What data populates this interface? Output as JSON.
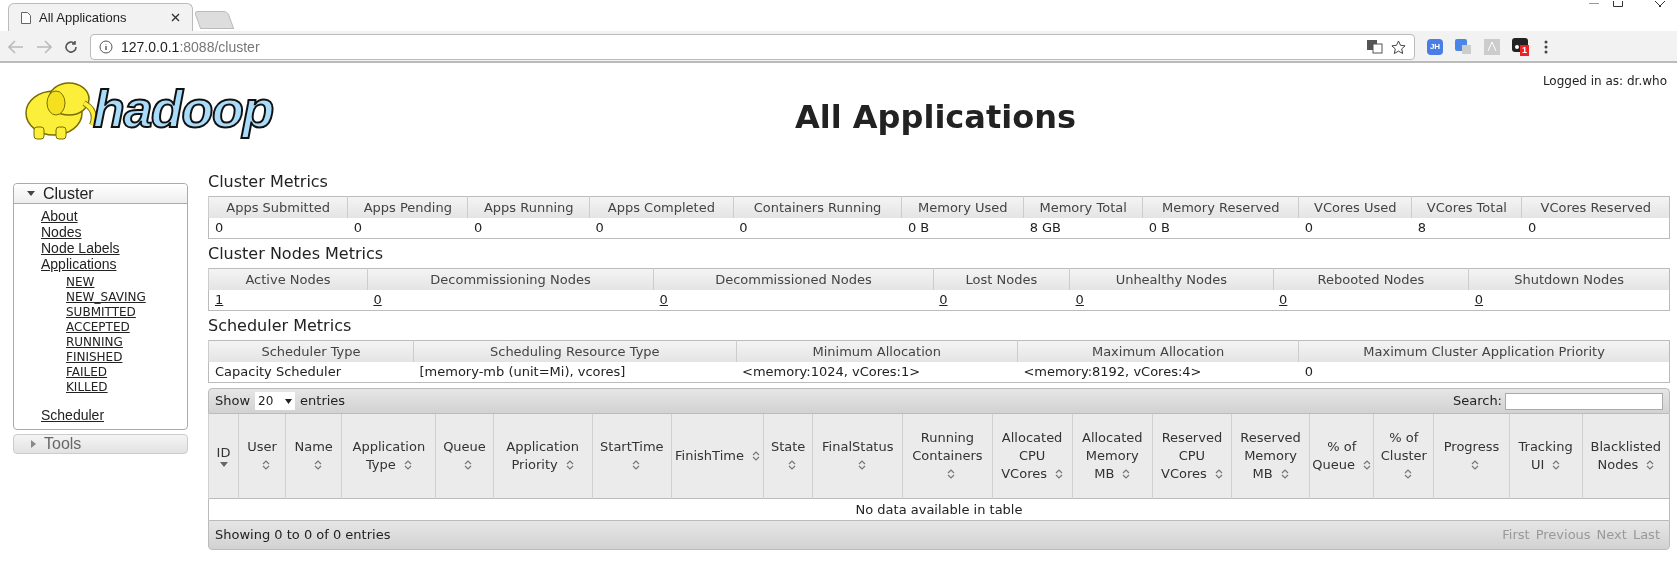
{
  "browser": {
    "tab_title": "All Applications",
    "address_host": "127.0.0.1",
    "address_rest": ":8088/cluster",
    "extension_label": "JH",
    "extension_badge": "1"
  },
  "header": {
    "logo_text": "hadoop",
    "title": "All Applications",
    "logged_in": "Logged in as: dr.who"
  },
  "sidebar": [
    {
      "label": "Cluster",
      "expanded": true,
      "children": [
        {
          "label": "About"
        },
        {
          "label": "Nodes"
        },
        {
          "label": "Node Labels"
        },
        {
          "label": "Applications",
          "children": [
            {
              "label": "NEW"
            },
            {
              "label": "NEW_SAVING"
            },
            {
              "label": "SUBMITTED"
            },
            {
              "label": "ACCEPTED"
            },
            {
              "label": "RUNNING"
            },
            {
              "label": "FINISHED"
            },
            {
              "label": "FAILED"
            },
            {
              "label": "KILLED"
            }
          ]
        },
        {
          "label": "Scheduler",
          "spaced": true
        }
      ]
    },
    {
      "label": "Tools",
      "expanded": false
    }
  ],
  "metrics": [
    {
      "title": "Cluster Metrics",
      "links": false,
      "columns": [
        "Apps Submitted",
        "Apps Pending",
        "Apps Running",
        "Apps Completed",
        "Containers Running",
        "Memory Used",
        "Memory Total",
        "Memory Reserved",
        "VCores Used",
        "VCores Total",
        "VCores Reserved"
      ],
      "row": [
        "0",
        "0",
        "0",
        "0",
        "0",
        "0 B",
        "8 GB",
        "0 B",
        "0",
        "8",
        "0"
      ]
    },
    {
      "title": "Cluster Nodes Metrics",
      "links": true,
      "columns": [
        "Active Nodes",
        "Decommissioning Nodes",
        "Decommissioned Nodes",
        "Lost Nodes",
        "Unhealthy Nodes",
        "Rebooted Nodes",
        "Shutdown Nodes"
      ],
      "row": [
        "1",
        "0",
        "0",
        "0",
        "0",
        "0",
        "0"
      ]
    },
    {
      "title": "Scheduler Metrics",
      "links": false,
      "columns": [
        "Scheduler Type",
        "Scheduling Resource Type",
        "Minimum Allocation",
        "Maximum Allocation",
        "Maximum Cluster Application Priority"
      ],
      "row": [
        "Capacity Scheduler",
        "[memory-mb (unit=Mi), vcores]",
        "<memory:1024, vCores:1>",
        "<memory:8192, vCores:4>",
        "0"
      ]
    }
  ],
  "applications": {
    "show_label": "Show",
    "page_size": "20",
    "entries_label": "entries",
    "search_label": "Search:",
    "columns": [
      {
        "label": "ID",
        "sorted": true
      },
      {
        "label": "User",
        "sorted": false
      },
      {
        "label": "Name",
        "sorted": false
      },
      {
        "label": "Application Type",
        "sorted": false
      },
      {
        "label": "Queue",
        "sorted": false
      },
      {
        "label": "Application Priority",
        "sorted": false
      },
      {
        "label": "StartTime",
        "sorted": false
      },
      {
        "label": "FinishTime",
        "sorted": false
      },
      {
        "label": "State",
        "sorted": false
      },
      {
        "label": "FinalStatus",
        "sorted": false
      },
      {
        "label": "Running Containers",
        "sorted": false
      },
      {
        "label": "Allocated CPU VCores",
        "sorted": false
      },
      {
        "label": "Allocated Memory MB",
        "sorted": false
      },
      {
        "label": "Reserved CPU VCores",
        "sorted": false
      },
      {
        "label": "Reserved Memory MB",
        "sorted": false
      },
      {
        "label": "% of Queue",
        "sorted": false
      },
      {
        "label": "% of Cluster",
        "sorted": false
      },
      {
        "label": "Progress",
        "sorted": false
      },
      {
        "label": "Tracking UI",
        "sorted": false
      },
      {
        "label": "Blacklisted Nodes",
        "sorted": false
      }
    ],
    "empty_message": "No data available in table",
    "info": "Showing 0 to 0 of 0 entries",
    "paginator": [
      {
        "label": "First",
        "disabled": true
      },
      {
        "label": "Previous",
        "disabled": true
      },
      {
        "label": "Next",
        "disabled": true
      },
      {
        "label": "Last",
        "disabled": true
      }
    ]
  }
}
